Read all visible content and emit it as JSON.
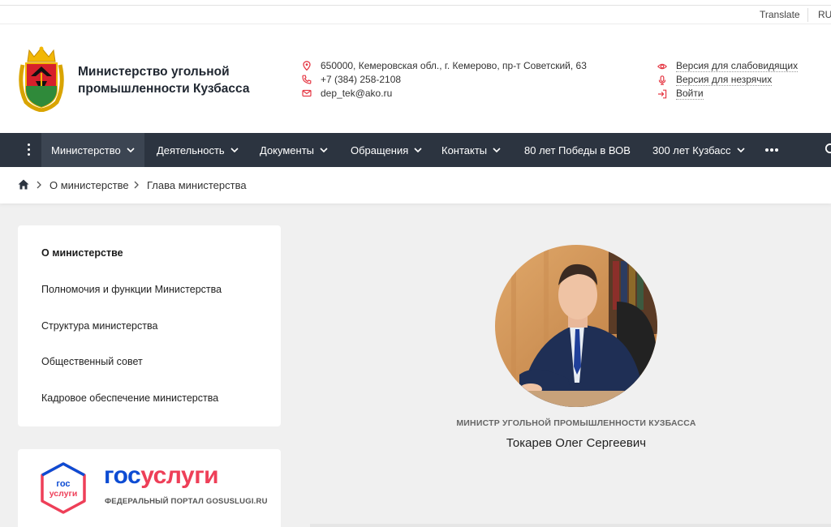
{
  "utility": {
    "translate": "Translate",
    "lang": "RU"
  },
  "header": {
    "ministry_name": "Министерство угольной промышленности Кузбасса",
    "contacts": {
      "address": "650000, Кемеровская обл., г. Кемерово, пр-т Советский, 63",
      "phone": "+7 (384) 258-2108",
      "email": "dep_tek@ako.ru"
    },
    "accessibility": {
      "low_vision": "Версия для слабовидящих",
      "blind": "Версия для незрячих",
      "login": "Войти"
    }
  },
  "nav": {
    "items": [
      {
        "label": "Министерство",
        "dropdown": true
      },
      {
        "label": "Деятельность",
        "dropdown": true
      },
      {
        "label": "Документы",
        "dropdown": true
      },
      {
        "label": "Обращения",
        "dropdown": true
      },
      {
        "label": "Контакты",
        "dropdown": true
      },
      {
        "label": "80 лет Победы в ВОВ",
        "dropdown": false
      },
      {
        "label": "300 лет Кузбасс",
        "dropdown": true
      }
    ]
  },
  "breadcrumb": {
    "items": [
      "О министерстве",
      "Глава министерства"
    ]
  },
  "sidebar": {
    "items": [
      {
        "label": "О министерстве"
      },
      {
        "label": "Полномочия и функции Министерства"
      },
      {
        "label": "Структура министерства"
      },
      {
        "label": "Общественный совет"
      },
      {
        "label": "Кадровое обеспечение министерства"
      }
    ]
  },
  "banner": {
    "logo_top": "гос",
    "logo_bottom": "услуги",
    "word_a": "гос",
    "word_b": "услуги",
    "subtitle": "ФЕДЕРАЛЬНЫЙ ПОРТАЛ GOSUSLUGI.RU"
  },
  "minister": {
    "title": "МИНИСТР УГОЛЬНОЙ ПРОМЫШЛЕННОСТИ КУЗБАССА",
    "name": "Токарев Олег Сергеевич"
  },
  "colors": {
    "nav_bg": "#2c3440",
    "accent_red": "#e53945",
    "gos_blue": "#0d4cd3",
    "gos_red": "#ee3f58"
  }
}
